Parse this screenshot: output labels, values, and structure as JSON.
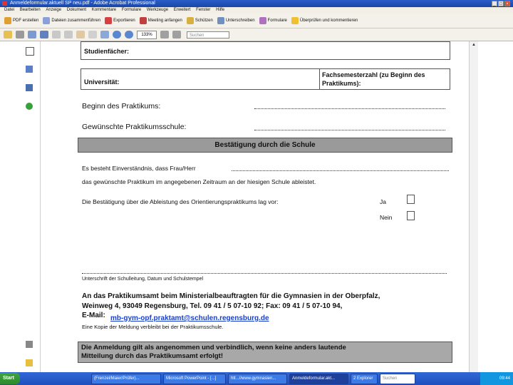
{
  "window": {
    "title": "Anmeldeformular.aktuell SP neu.pdf - Adobe Acrobat Professional"
  },
  "menubar": [
    "Datei",
    "Bearbeiten",
    "Anzeige",
    "Dokument",
    "Kommentare",
    "Formulare",
    "Werkzeuge",
    "Erweitert",
    "Fenster",
    "Hilfe"
  ],
  "toolbar1": [
    "PDF erstellen",
    "Dateien zusammenführen",
    "Exportieren",
    "Meeting anfangen",
    "Schützen",
    "Unterschreiben",
    "Formulare",
    "Überprüfen und kommentieren"
  ],
  "toolbar2": {
    "zoom": "133%",
    "search_placeholder": "Suchen"
  },
  "form": {
    "studienfaecher": "Studienfächer:",
    "universitaet": "Universität:",
    "fachsemester": "Fachsemesterzahl (zu Beginn des Praktikums):",
    "beginn": "Beginn des Praktikums:",
    "praktikumsschule": "Gewünschte Praktikumsschule:",
    "bestaetigung_header": "Bestätigung durch die Schule",
    "einverstaendnis": "Es besteht Einverständnis, dass Frau/Herr",
    "zeitraum": "das gewünschte Praktikum im angegebenen Zeitraum an der hiesigen Schule ableistet.",
    "orientierung": "Die Bestätigung über die Ableistung des Orientierungspraktikums lag vor:",
    "ja": "Ja",
    "nein": "Nein",
    "unterschrift": "Unterschrift der Schulleitung, Datum und Schulstempel",
    "address_line1": "An das Praktikumsamt beim Ministerialbeauftragten für die Gymnasien in der Oberpfalz,",
    "address_line2": "Weinweg 4, 93049 Regensburg, Tel. 09 41 / 5 07-10 92; Fax: 09 41 / 5 07-10 94,",
    "email_label": "E-Mail:",
    "email": "mb-gym-opf.praktamt@schulen.regensburg.de",
    "kopie": "Eine Kopie der Meldung verbleibt bei der Praktikumsschule.",
    "footer_line1": "Die Anmeldung gilt als angenommen und verbindlich, wenn keine anders lautende",
    "footer_line2": "Mitteilung durch das Praktikumsamt erfolgt!"
  },
  "taskbar": {
    "start": "Start",
    "items": [
      "(Frenzel/Maier/Prüfer)...",
      "Microsoft PowerPoint - [...]",
      "htt...//www.gymnasien...",
      "Anmeldeformular.akt...",
      "2 Explorer"
    ],
    "search": "Suchen",
    "clock": "09:44"
  }
}
